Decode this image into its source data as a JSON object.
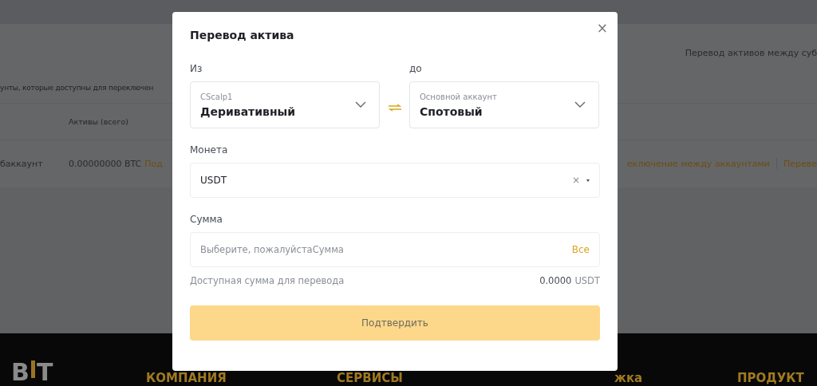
{
  "background": {
    "subtitle_fragment": "унты, которые доступны для переключен",
    "right_heading_fragment": "Перевод активов между суб",
    "table": {
      "column_header": "Активы (всего)",
      "row": {
        "account_fragment": "баккаунт",
        "assets": "0.00000000 BTC",
        "action_left_fragment": "Под",
        "action_right_fragment": "еключение между аккаунтами",
        "action_last_fragment": "Переве"
      }
    },
    "footer": {
      "logo_left": "B",
      "logo_right": "T",
      "headings": [
        "КОМПАНИЯ",
        "СЕРВИСЫ",
        "жка",
        "ПРОДУКТ"
      ]
    }
  },
  "dialog": {
    "title": "Перевод актива",
    "close": "×",
    "from": {
      "label": "Из",
      "account": "CScalp1",
      "type": "Деривативный"
    },
    "to": {
      "label": "до",
      "account": "Основной аккаунт",
      "type": "Спотовый"
    },
    "coin": {
      "label": "Монета",
      "value": "USDT",
      "clear": "×"
    },
    "amount": {
      "label": "Сумма",
      "placeholder": "Выберите, пожалуйстаСумма",
      "all_button": "Все"
    },
    "available": {
      "label": "Доступная сумма для перевода",
      "value": "0.0000",
      "unit": "USDT"
    },
    "confirm": {
      "label": "Подтвердить",
      "disabled": true
    }
  }
}
